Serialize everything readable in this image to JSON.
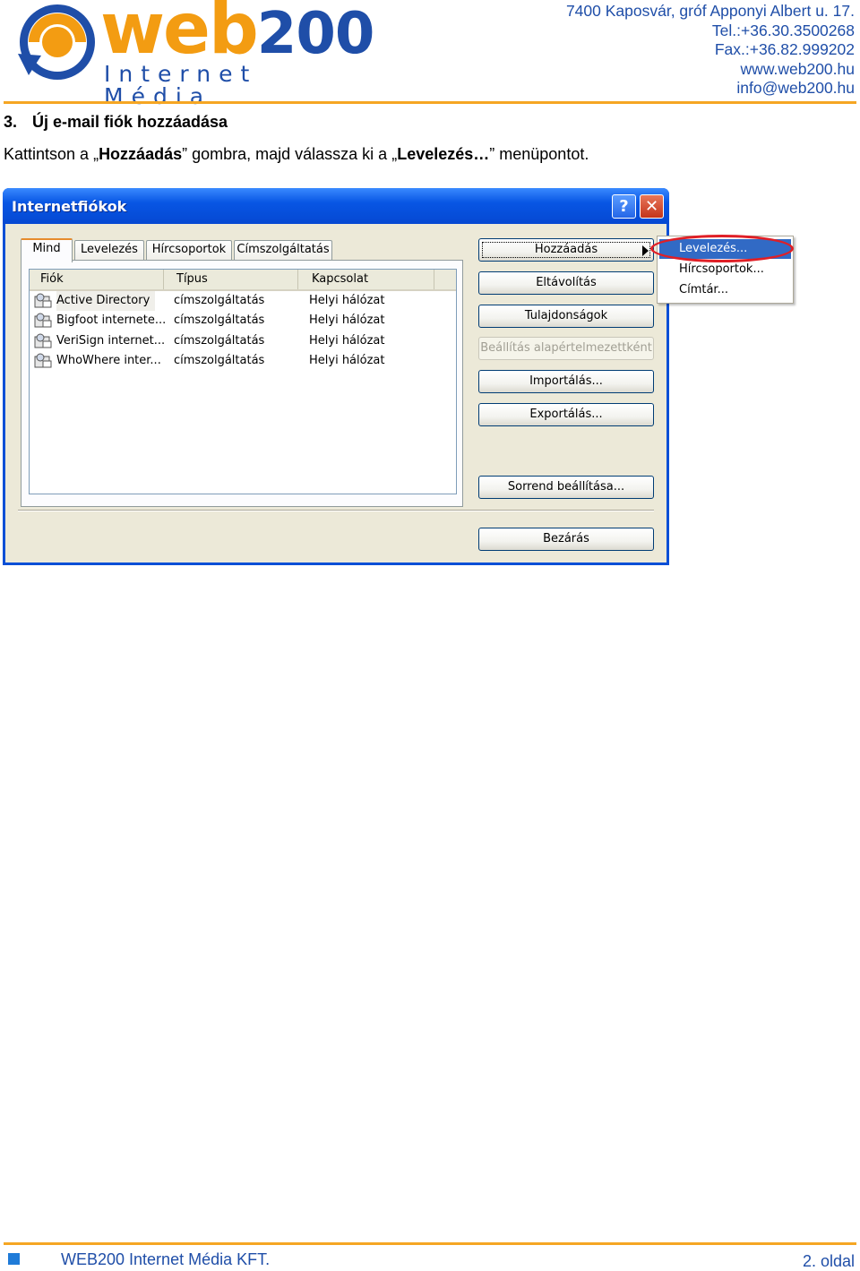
{
  "header": {
    "logo": {
      "word": "web",
      "number": "200",
      "subtitle": "Internet Média"
    },
    "contact_lines": [
      "7400 Kaposvár, gróf Apponyi Albert u. 17.",
      "Tel.:+36.30.3500268",
      "Fax.:+36.82.999202",
      "www.web200.hu",
      "info@web200.hu"
    ]
  },
  "section": {
    "number": "3.",
    "title": "Új e-mail fiók hozzáadása",
    "instruction": {
      "part1": "Kattintson a „",
      "bold1": "Hozzáadás",
      "part2": "” gombra, majd válassza ki a „",
      "bold2": "Levelezés…",
      "part3": "” menüpontot."
    }
  },
  "dialog": {
    "title": "Internetfiókok",
    "help_glyph": "?",
    "close_glyph": "✕",
    "tabs": [
      "Mind",
      "Levelezés",
      "Hírcsoportok",
      "Címszolgáltatás"
    ],
    "active_tab": "Mind",
    "columns": [
      "Fiók",
      "Típus",
      "Kapcsolat"
    ],
    "rows": [
      {
        "account": "Active Directory",
        "type": "címszolgáltatás",
        "connection": "Helyi hálózat"
      },
      {
        "account": "Bigfoot internete...",
        "type": "címszolgáltatás",
        "connection": "Helyi hálózat"
      },
      {
        "account": "VeriSign internet...",
        "type": "címszolgáltatás",
        "connection": "Helyi hálózat"
      },
      {
        "account": "WhoWhere inter...",
        "type": "címszolgáltatás",
        "connection": "Helyi hálózat"
      }
    ],
    "buttons": {
      "add": "Hozzáadás",
      "remove": "Eltávolítás",
      "properties": "Tulajdonságok",
      "set_default": "Beállítás alapértelmezettként",
      "import": "Importálás...",
      "export": "Exportálás...",
      "order": "Sorrend beállítása...",
      "close": "Bezárás"
    },
    "add_menu": [
      "Levelezés...",
      "Hírcsoportok...",
      "Címtár..."
    ],
    "selected_menu_item": "Levelezés..."
  },
  "footer": {
    "company": "WEB200 Internet Média KFT.",
    "page": "2. oldal"
  },
  "colors": {
    "brand_orange": "#f39c12",
    "brand_blue": "#1f4ea8",
    "rule_orange": "#f5a623",
    "xp_title_blue": "#0548d2",
    "highlight_red": "#e01f26",
    "menu_selection": "#316ac5"
  }
}
